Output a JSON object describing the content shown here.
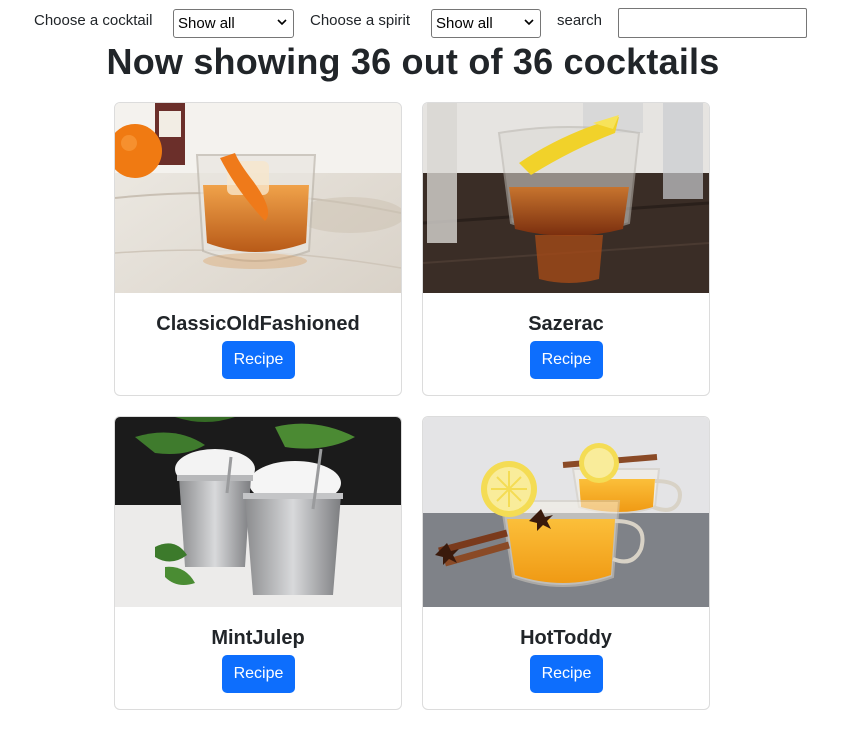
{
  "filters": {
    "cocktail_label": "Choose a cocktail",
    "cocktail_selected": "Show all",
    "spirit_label": "Choose a spirit",
    "spirit_selected": "Show all",
    "search_label": "search",
    "search_value": ""
  },
  "heading": "Now showing 36 out of 36 cocktails",
  "cards": [
    {
      "name": "ClassicOldFashioned",
      "button": "Recipe"
    },
    {
      "name": "Sazerac",
      "button": "Recipe"
    },
    {
      "name": "MintJulep",
      "button": "Recipe"
    },
    {
      "name": "HotToddy",
      "button": "Recipe"
    }
  ],
  "colors": {
    "button": "#0d6efd",
    "text": "#212529"
  }
}
